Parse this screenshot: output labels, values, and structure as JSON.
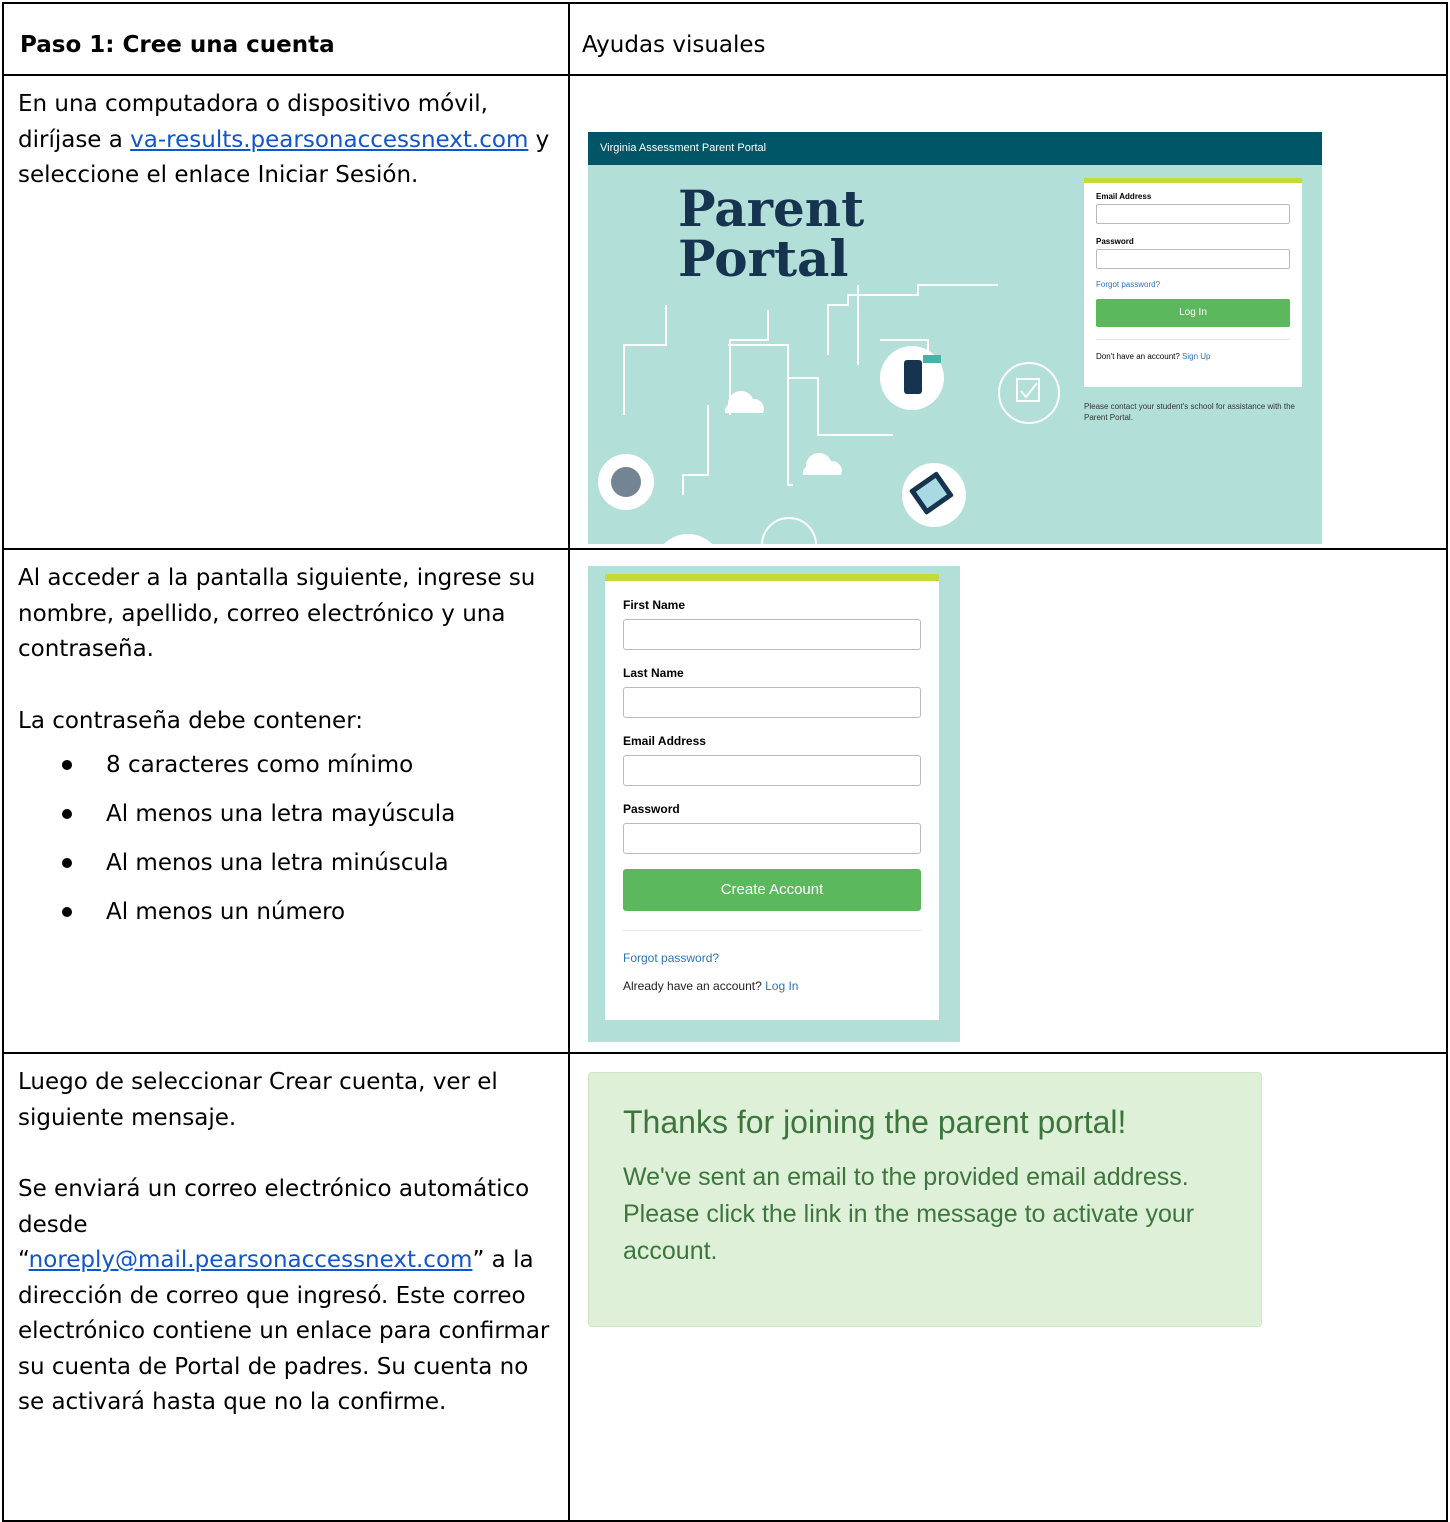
{
  "header": {
    "step_title": "Paso 1:  Cree una cuenta",
    "visual_title": "Ayudas visuales"
  },
  "row1": {
    "text_before": "En una computadora o dispositivo móvil, diríjase a ",
    "link": "va-results.pearsonaccessnext.com",
    "text_after": " y seleccione el enlace Iniciar Sesión."
  },
  "row2": {
    "intro": "Al acceder a la pantalla siguiente, ingrese su nombre, apellido, correo electrónico y una contraseña.",
    "req_title": "La contraseña debe contener:",
    "requirements": [
      "8 caracteres como mínimo",
      "Al menos una letra mayúscula",
      "Al menos una letra minúscula",
      "Al menos un número"
    ]
  },
  "row3": {
    "p1": "Luego de seleccionar Crear cuenta, ver el siguiente mensaje.",
    "p2_before": "Se enviará un correo electrónico automático desde “",
    "p2_link": "noreply@mail.pearsonaccessnext.com",
    "p2_after": "” a la dirección de correo que ingresó. Este correo electrónico contiene un enlace para confirmar su cuenta de Portal de padres. Su cuenta no se activará hasta que no la confirme."
  },
  "shot1": {
    "bar_title": "Virginia Assessment Parent Portal",
    "big_line1": "Parent",
    "big_line2": "Portal",
    "email_label": "Email Address",
    "password_label": "Password",
    "forgot": "Forgot password?",
    "login_button": "Log In",
    "no_account": "Don't have an account? ",
    "sign_up": "Sign Up",
    "help_text": "Please contact your student's school for assistance with the Parent Portal.",
    "colors": {
      "bar": "#005666",
      "bg": "#b3dfd9",
      "accent": "#c6d93a",
      "button": "#5cb85c"
    }
  },
  "shot2": {
    "first_name": "First Name",
    "last_name": "Last Name",
    "email_label": "Email Address",
    "password_label": "Password",
    "create_button": "Create Account",
    "forgot": "Forgot password?",
    "have_account": "Already have an account? ",
    "log_in": "Log In"
  },
  "shot3": {
    "title": "Thanks for joining the parent portal!",
    "message": "We've sent an email to the provided email address. Please click the link in the message to activate your account.",
    "colors": {
      "bg": "#dff0d8",
      "text": "#3c763d"
    }
  }
}
